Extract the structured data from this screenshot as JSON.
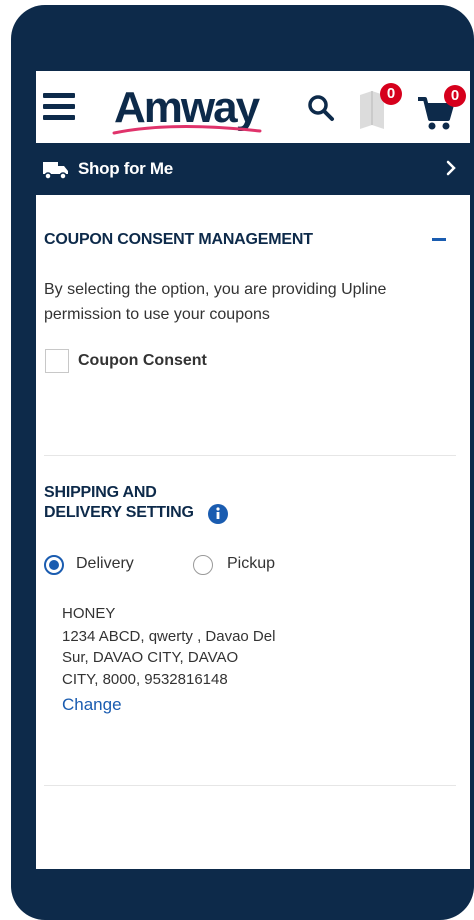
{
  "header": {
    "logo_text": "Amway",
    "wishlist_count": "0",
    "cart_count": "0"
  },
  "shop_bar": {
    "label_prefix": "Shop for",
    "label_suffix": "Me"
  },
  "coupon_section": {
    "title": "COUPON CONSENT MANAGEMENT",
    "description": "By selecting the option, you are providing Upline permission to use your coupons",
    "checkbox_label": "Coupon Consent"
  },
  "shipping_section": {
    "title_line1": "SHIPPING AND",
    "title_line2": "DELIVERY SETTING",
    "options": {
      "delivery": "Delivery",
      "pickup": "Pickup"
    },
    "selected": "delivery",
    "address": {
      "name": "HONEY",
      "line1": "1234 ABCD, qwerty , Davao Del",
      "line2": "Sur, DAVAO CITY, DAVAO",
      "line3": "CITY, 8000, 9532816148"
    },
    "change_label": "Change"
  },
  "colors": {
    "navy": "#0d2a4a",
    "accent_blue": "#1a5cb0",
    "badge_red": "#d6001c",
    "swoosh_pink": "#e0336b"
  }
}
